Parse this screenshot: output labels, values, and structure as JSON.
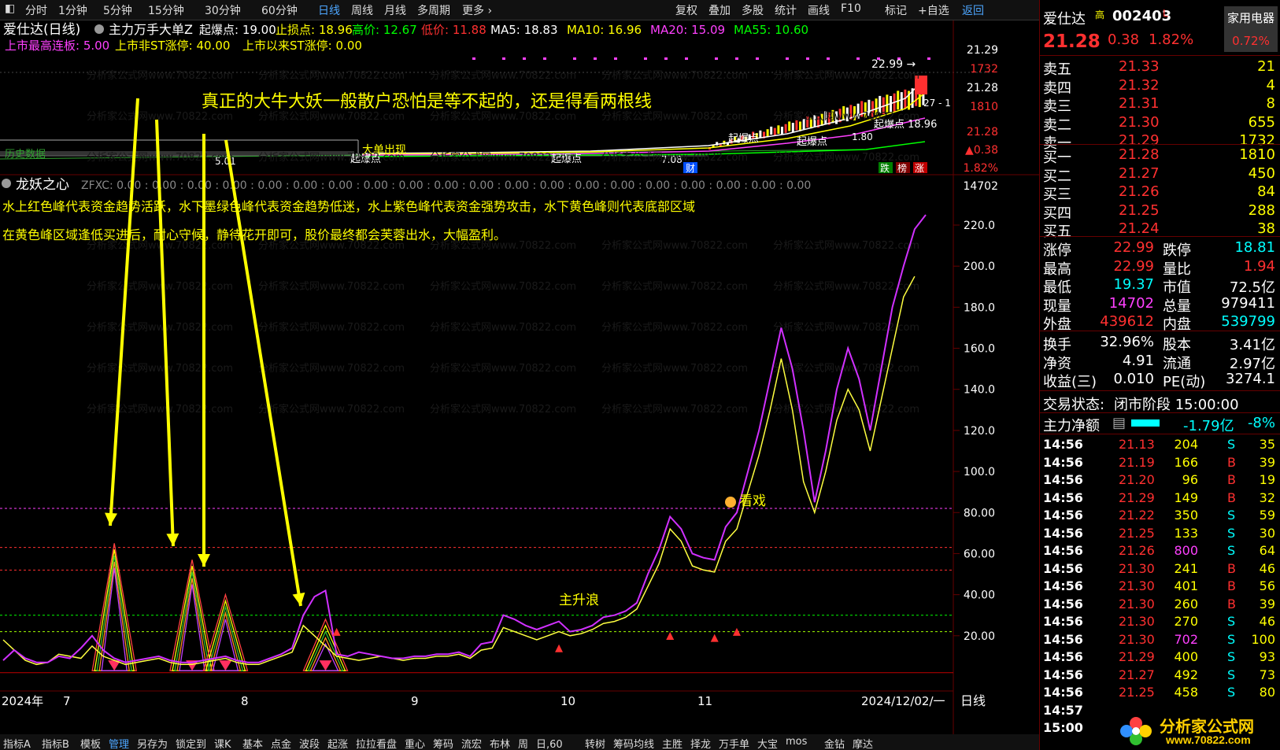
{
  "topbar": {
    "periods": [
      "分时",
      "1分钟",
      "5分钟",
      "15分钟",
      "30分钟",
      "60分钟",
      "日线",
      "周线",
      "月线",
      "多周期",
      "更多"
    ],
    "active_period": "日线",
    "tools": [
      "复权",
      "叠加",
      "多股",
      "统计",
      "画线",
      "F10",
      "标记",
      "+自选",
      "返回"
    ]
  },
  "main_chart": {
    "title": "爱仕达(日线)",
    "indicator_name": "主力万手大单Z",
    "header_values": [
      {
        "label": "起爆点:",
        "value": "19.00",
        "color": "#ffffff"
      },
      {
        "label": "止损点:",
        "value": "18.96",
        "color": "#ffff00"
      },
      {
        "label": "高价:",
        "value": "12.67",
        "color": "#00ff00"
      },
      {
        "label": "低价:",
        "value": "11.88",
        "color": "#ff3030"
      },
      {
        "label": "MA5:",
        "value": "18.83",
        "color": "#ffffff"
      },
      {
        "label": "MA10:",
        "value": "16.96",
        "color": "#ffff00"
      },
      {
        "label": "MA20:",
        "value": "15.09",
        "color": "#ff40ff"
      },
      {
        "label": "MA55:",
        "value": "10.60",
        "color": "#00ff00"
      }
    ],
    "line2": [
      {
        "text": "上市最高连板: 5.00",
        "color": "#ff40ff"
      },
      {
        "text": "上市非ST涨停: 40.00",
        "color": "#ffff00"
      },
      {
        "text": "上市以来ST涨停: 0.00",
        "color": "#ffff00"
      }
    ],
    "annotation": "真正的大牛大妖一般散户恐怕是等不起的，还是得看两根线",
    "price_labels": [
      "21.29",
      "1732",
      "21.28",
      "1810",
      "21.28",
      "▲0.38",
      "1.82%",
      "14702"
    ],
    "high_label": "22.99",
    "other_labels": [
      "起爆点",
      "起爆点",
      "起爆点",
      "起爆点",
      "大单出现",
      "1.80",
      "5.01",
      "7.08",
      "财",
      "跌",
      "榜",
      "涨",
      "起爆点 18.96",
      "27 - 1",
      "历史数据"
    ]
  },
  "sub_chart": {
    "title": "龙妖之心",
    "zfxc": "ZFXC: 0.00 : 0.00 : 0.00 : 0.00 : 0.00 : 0.00 : 0.00 : 0.00 : 0.00 : 0.00 : 0.00 : 0.00 : 0.00 : 0.00 : 0.00 : 0.00 : 0.00 : 0.00 : 0.00 : 0.00",
    "desc1": "水上红色峰代表资金趋势活跃，水下墨绿色峰代表资金趋势低迷，水上紫色峰代表资金强势攻击，水下黄色峰则代表底部区域",
    "desc2": "在黄色峰区域逢低买进后，耐心守候，静待花开即可，股价最终都会芙蓉出水，大幅盈利。",
    "label_zsl": "主升浪",
    "label_kx": "看戏",
    "watermark": "分析家公式网www.70822.com",
    "y_ticks": [
      "220.0",
      "200.0",
      "180.0",
      "160.0",
      "140.0",
      "120.0",
      "100.0",
      "80.00",
      "60.00",
      "40.00",
      "20.00"
    ],
    "x_ticks": [
      "2024年",
      "7",
      "8",
      "9",
      "10",
      "11",
      "2024/12/02/一"
    ],
    "period_label": "日线",
    "purple_line": [
      8,
      13,
      9,
      7,
      7,
      10,
      9,
      14,
      20,
      13,
      9,
      7,
      8,
      9,
      10,
      8,
      7,
      7,
      8,
      9,
      10,
      8,
      7,
      7,
      9,
      11,
      14,
      30,
      39,
      42,
      11,
      10,
      12,
      11,
      10,
      9,
      9,
      10,
      10,
      11,
      11,
      12,
      10,
      16,
      17,
      30,
      28,
      25,
      23,
      25,
      27,
      22,
      23,
      25,
      29,
      30,
      32,
      36,
      50,
      62,
      78,
      72,
      60,
      58,
      57,
      73,
      80,
      100,
      120,
      145,
      170,
      150,
      120,
      85,
      110,
      140,
      160,
      145,
      120,
      150,
      180,
      200,
      218,
      225
    ],
    "yellow_line": [
      18,
      13,
      8,
      6,
      7,
      11,
      10,
      9,
      15,
      10,
      8,
      6,
      7,
      8,
      9,
      7,
      6,
      6,
      7,
      8,
      9,
      7,
      6,
      6,
      8,
      10,
      12,
      25,
      20,
      15,
      10,
      9,
      8,
      9,
      10,
      9,
      8,
      9,
      9,
      10,
      10,
      11,
      9,
      13,
      14,
      24,
      22,
      20,
      18,
      20,
      22,
      20,
      21,
      23,
      26,
      27,
      29,
      33,
      44,
      55,
      72,
      66,
      54,
      52,
      51,
      66,
      72,
      90,
      108,
      130,
      155,
      130,
      95,
      80,
      100,
      125,
      140,
      130,
      110,
      135,
      160,
      185,
      195
    ],
    "peaks_left": [
      {
        "t": 10,
        "h": 65
      },
      {
        "t": 17,
        "h": 57
      },
      {
        "t": 20,
        "h": 40
      },
      {
        "t": 29,
        "h": 28
      }
    ]
  },
  "right_panel": {
    "name": "爱仕达",
    "name_badge": "高",
    "code": "002403",
    "code_suffix": "L",
    "sector": "家用电器",
    "price": "21.28",
    "change": "0.38",
    "change_pct": "1.82%",
    "sector_pct": "0.72%",
    "asks": [
      {
        "label": "卖五",
        "price": "21.33",
        "vol": "21"
      },
      {
        "label": "卖四",
        "price": "21.32",
        "vol": "4"
      },
      {
        "label": "卖三",
        "price": "21.31",
        "vol": "8"
      },
      {
        "label": "卖二",
        "price": "21.30",
        "vol": "655"
      },
      {
        "label": "卖一",
        "price": "21.29",
        "vol": "1732"
      }
    ],
    "bids": [
      {
        "label": "买一",
        "price": "21.28",
        "vol": "1810"
      },
      {
        "label": "买二",
        "price": "21.27",
        "vol": "450"
      },
      {
        "label": "买三",
        "price": "21.26",
        "vol": "84"
      },
      {
        "label": "买四",
        "price": "21.25",
        "vol": "288"
      },
      {
        "label": "买五",
        "price": "21.24",
        "vol": "38"
      }
    ],
    "stats": [
      [
        {
          "l": "涨停",
          "v": "22.99",
          "c": "#ff3030"
        },
        {
          "l": "跌停",
          "v": "18.81",
          "c": "#00ffff"
        }
      ],
      [
        {
          "l": "最高",
          "v": "22.99",
          "c": "#ff3030"
        },
        {
          "l": "量比",
          "v": "1.94",
          "c": "#ff3030"
        }
      ],
      [
        {
          "l": "最低",
          "v": "19.37",
          "c": "#00ffff"
        },
        {
          "l": "市值",
          "v": "72.5亿",
          "c": "#ffffff"
        }
      ],
      [
        {
          "l": "现量",
          "v": "14702",
          "c": "#ff40ff"
        },
        {
          "l": "总量",
          "v": "979411",
          "c": "#ffffff"
        }
      ],
      [
        {
          "l": "外盘",
          "v": "439612",
          "c": "#ff3030"
        },
        {
          "l": "内盘",
          "v": "539799",
          "c": "#00ffff"
        }
      ]
    ],
    "stats2": [
      [
        {
          "l": "换手",
          "v": "32.96%",
          "c": "#ffffff"
        },
        {
          "l": "股本",
          "v": "3.41亿",
          "c": "#ffffff"
        }
      ],
      [
        {
          "l": "净资",
          "v": "4.91",
          "c": "#ffffff"
        },
        {
          "l": "流通",
          "v": "2.97亿",
          "c": "#ffffff"
        }
      ],
      [
        {
          "l": "收益(三)",
          "v": "0.010",
          "c": "#ffffff"
        },
        {
          "l": "PE(动)",
          "v": "3274.1",
          "c": "#ffffff"
        }
      ]
    ],
    "trade_status_label": "交易状态:",
    "trade_status": "闭市阶段 15:00:00",
    "main_net_label": "主力净额",
    "main_net_value": "-1.79亿",
    "main_net_pct": "-8%",
    "ticks": [
      {
        "t": "14:56",
        "p": "21.13",
        "v": "204",
        "s": "S",
        "n": "35"
      },
      {
        "t": "14:56",
        "p": "21.19",
        "v": "166",
        "s": "B",
        "n": "39"
      },
      {
        "t": "14:56",
        "p": "21.20",
        "v": "96",
        "s": "B",
        "n": "19"
      },
      {
        "t": "14:56",
        "p": "21.29",
        "v": "149",
        "s": "B",
        "n": "32"
      },
      {
        "t": "14:56",
        "p": "21.22",
        "v": "350",
        "s": "S",
        "n": "59"
      },
      {
        "t": "14:56",
        "p": "21.25",
        "v": "133",
        "s": "S",
        "n": "30"
      },
      {
        "t": "14:56",
        "p": "21.26",
        "v": "800",
        "s": "S",
        "n": "64"
      },
      {
        "t": "14:56",
        "p": "21.30",
        "v": "241",
        "s": "B",
        "n": "46"
      },
      {
        "t": "14:56",
        "p": "21.30",
        "v": "401",
        "s": "B",
        "n": "56"
      },
      {
        "t": "14:56",
        "p": "21.30",
        "v": "260",
        "s": "B",
        "n": "39"
      },
      {
        "t": "14:56",
        "p": "21.30",
        "v": "270",
        "s": "S",
        "n": "46"
      },
      {
        "t": "14:56",
        "p": "21.30",
        "v": "702",
        "s": "S",
        "n": "100"
      },
      {
        "t": "14:56",
        "p": "21.29",
        "v": "400",
        "s": "S",
        "n": "93"
      },
      {
        "t": "14:56",
        "p": "21.27",
        "v": "492",
        "s": "S",
        "n": "73"
      },
      {
        "t": "14:56",
        "p": "21.25",
        "v": "458",
        "s": "S",
        "n": "80"
      },
      {
        "t": "14:57",
        "p": "",
        "v": "",
        "s": "",
        "n": ""
      },
      {
        "t": "15:00",
        "p": "",
        "v": "",
        "s": "",
        "n": ""
      }
    ]
  },
  "bottom_tabs": [
    "指标A",
    "指标B",
    "模板",
    "管理",
    "另存为",
    "锁定到",
    "课K",
    "基本",
    "点金",
    "波段",
    "起涨",
    "拉拉看盘",
    "重心",
    "筹码",
    "流宏",
    "布林",
    "周",
    "日,60",
    "转树",
    "筹码均线",
    "主胜",
    "择龙",
    "万手单",
    "大宝",
    "mos",
    "金钻",
    "摩达"
  ],
  "logo_text": "分析家公式网",
  "logo_url": "www.70822.com"
}
